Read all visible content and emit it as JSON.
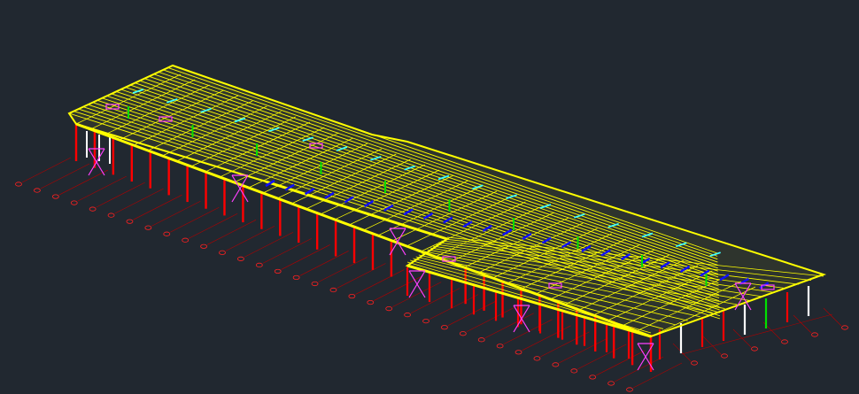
{
  "viewport": {
    "background": "#212830"
  },
  "colors": {
    "roof_beams": "#ffff00",
    "columns": "#ff0000",
    "grid_lines": "#b00000",
    "grid_bubbles": "#ff2020",
    "bracing": "#ff40ff",
    "purlins_blue": "#1010ff",
    "secondary_green": "#00e000",
    "secondary_cyan": "#40ffff",
    "white_members": "#ffffff"
  },
  "model": {
    "description": "structural-steel-frame-3d-view",
    "icons": [
      "grid-bubble-icon"
    ]
  }
}
